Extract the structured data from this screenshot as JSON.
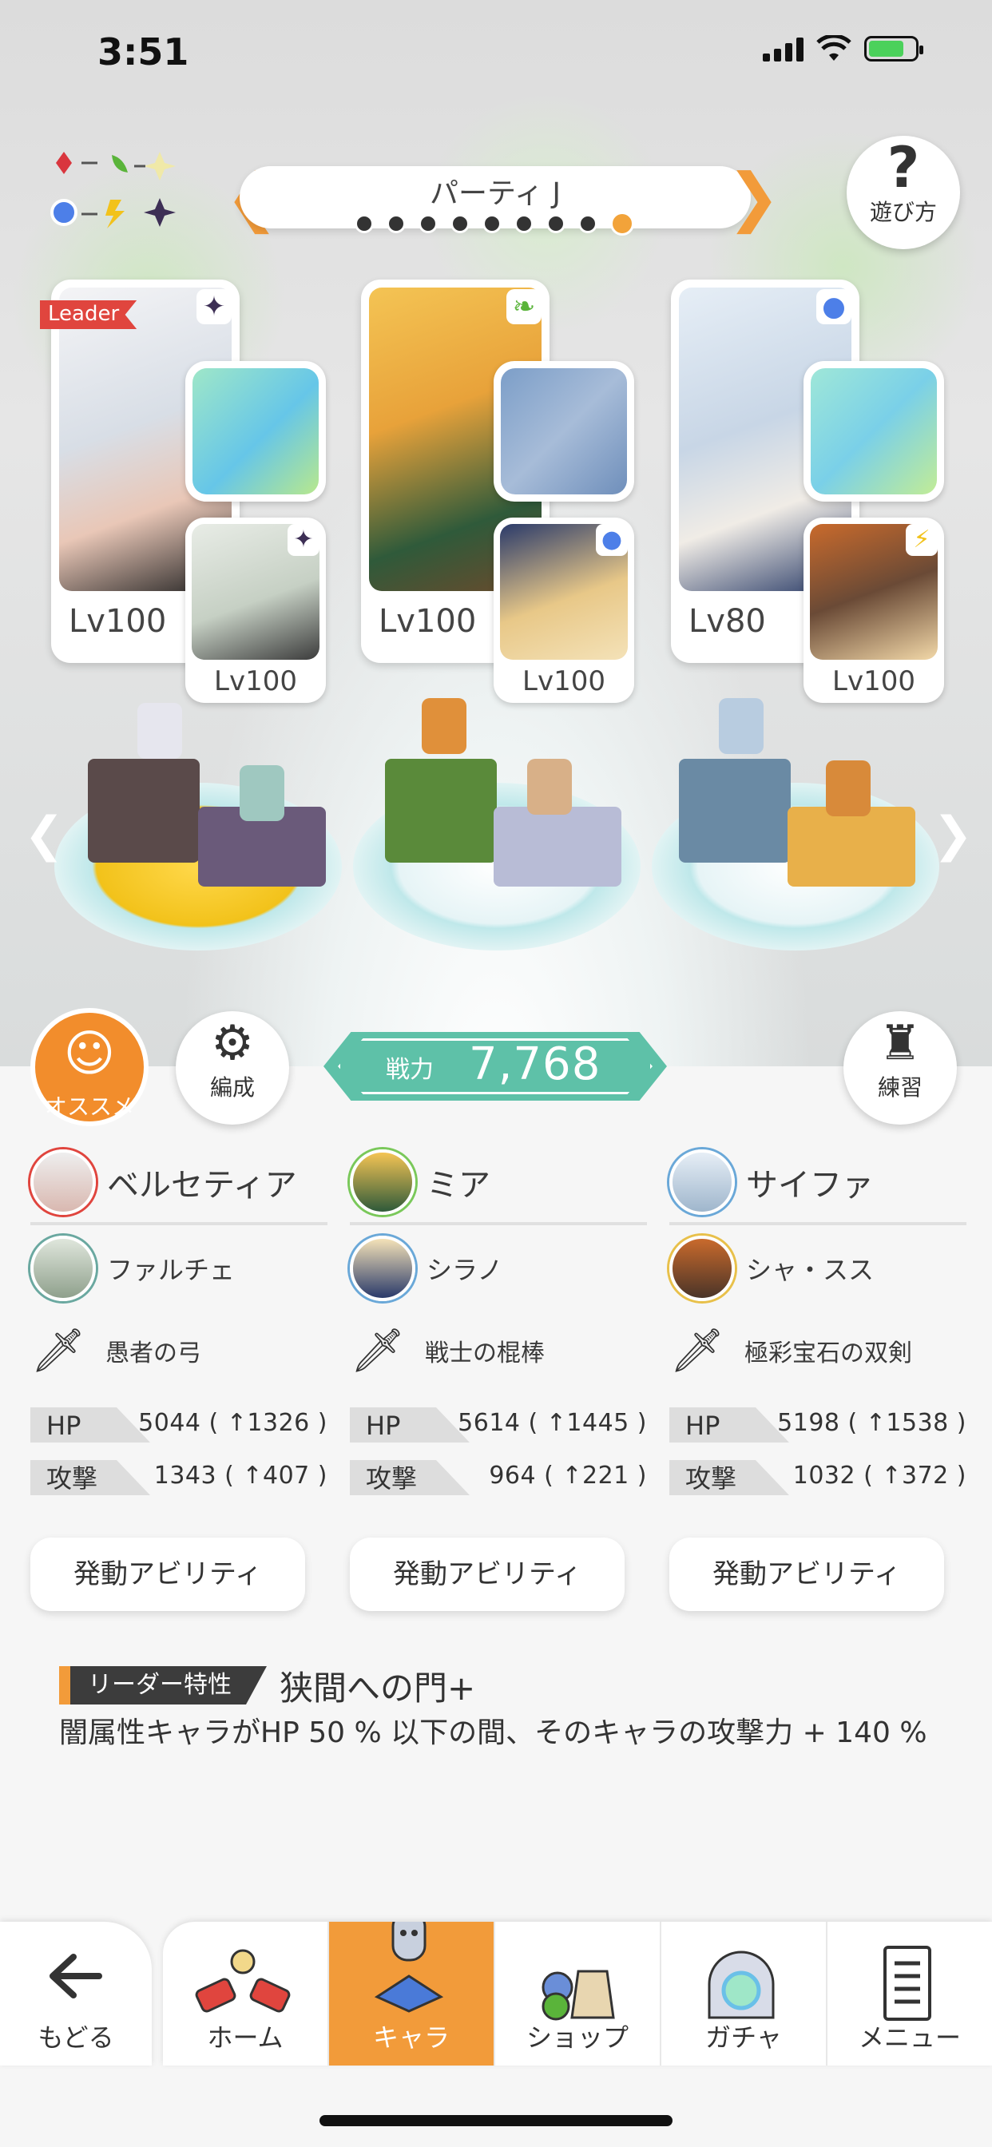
{
  "status_bar": {
    "time": "3:51"
  },
  "party": {
    "name": "パーティ J",
    "page_count": 9,
    "active_page": 9
  },
  "help_button": {
    "symbol": "?",
    "label": "遊び方"
  },
  "leader_badge": "Leader",
  "members": [
    {
      "name": "ベルセティア",
      "level": "Lv100",
      "element": "dark",
      "sub_name": "ファルチェ",
      "sub_level": "Lv100",
      "sub_element": "dark",
      "weapon": "愚者の弓",
      "hp_label": "HP",
      "hp": "5044 ( ↑1326 )",
      "atk_label": "攻撃",
      "atk": "1343 ( ↑407 )",
      "ability_label": "発動アビリティ"
    },
    {
      "name": "ミア",
      "level": "Lv100",
      "element": "wind",
      "sub_name": "シラノ",
      "sub_level": "Lv100",
      "sub_element": "water",
      "weapon": "戦士の棍棒",
      "hp_label": "HP",
      "hp": "5614 ( ↑1445 )",
      "atk_label": "攻撃",
      "atk": "964 ( ↑221 )",
      "ability_label": "発動アビリティ"
    },
    {
      "name": "サイファ",
      "level": "Lv80",
      "element": "water",
      "sub_name": "シャ・スス",
      "sub_level": "Lv100",
      "sub_element": "thunder",
      "weapon": "極彩宝石の双剣",
      "hp_label": "HP",
      "hp": "5198 ( ↑1538 )",
      "atk_label": "攻撃",
      "atk": "1032 ( ↑372 )",
      "ability_label": "発動アビリティ"
    }
  ],
  "actions": {
    "recommend": "オススメ",
    "formation": "編成",
    "practice": "練習"
  },
  "power": {
    "label": "戦力",
    "value": "7,768"
  },
  "leader_skill": {
    "label": "リーダー特性",
    "name": "狭間への門+",
    "description": "闇属性キャラがHP 50 % 以下の間、そのキャラの攻撃力 + 140 %"
  },
  "nav": {
    "back": "もどる",
    "tabs": [
      "ホーム",
      "キャラ",
      "ショップ",
      "ガチャ",
      "メニュー"
    ],
    "active_tab": "キャラ"
  },
  "colors": {
    "accent": "#f29b3a",
    "power": "#5ec1a8",
    "leader_tag": "#e0453e"
  }
}
